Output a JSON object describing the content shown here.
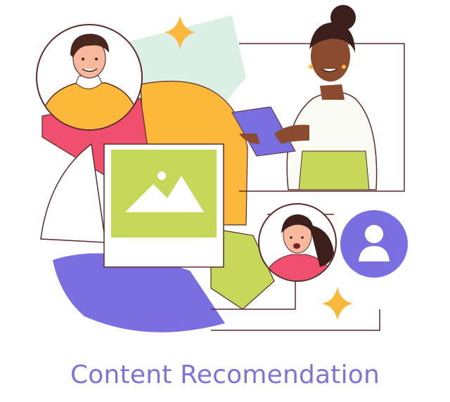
{
  "caption": {
    "text": "Content Recomendation"
  },
  "icons": [
    "sparkle-icon",
    "image-placeholder-icon",
    "user-avatar-icon",
    "tablet-icon"
  ],
  "colors": {
    "caption": "#7e74d8",
    "purple": "#7a6fe0",
    "orange": "#fbb83a",
    "coral": "#f0506e",
    "lime": "#c6d85a",
    "mint": "#dcefe6",
    "outline": "#5b2b2b",
    "skin_dark": "#8a4b2e",
    "hair": "#3c1f1a"
  }
}
